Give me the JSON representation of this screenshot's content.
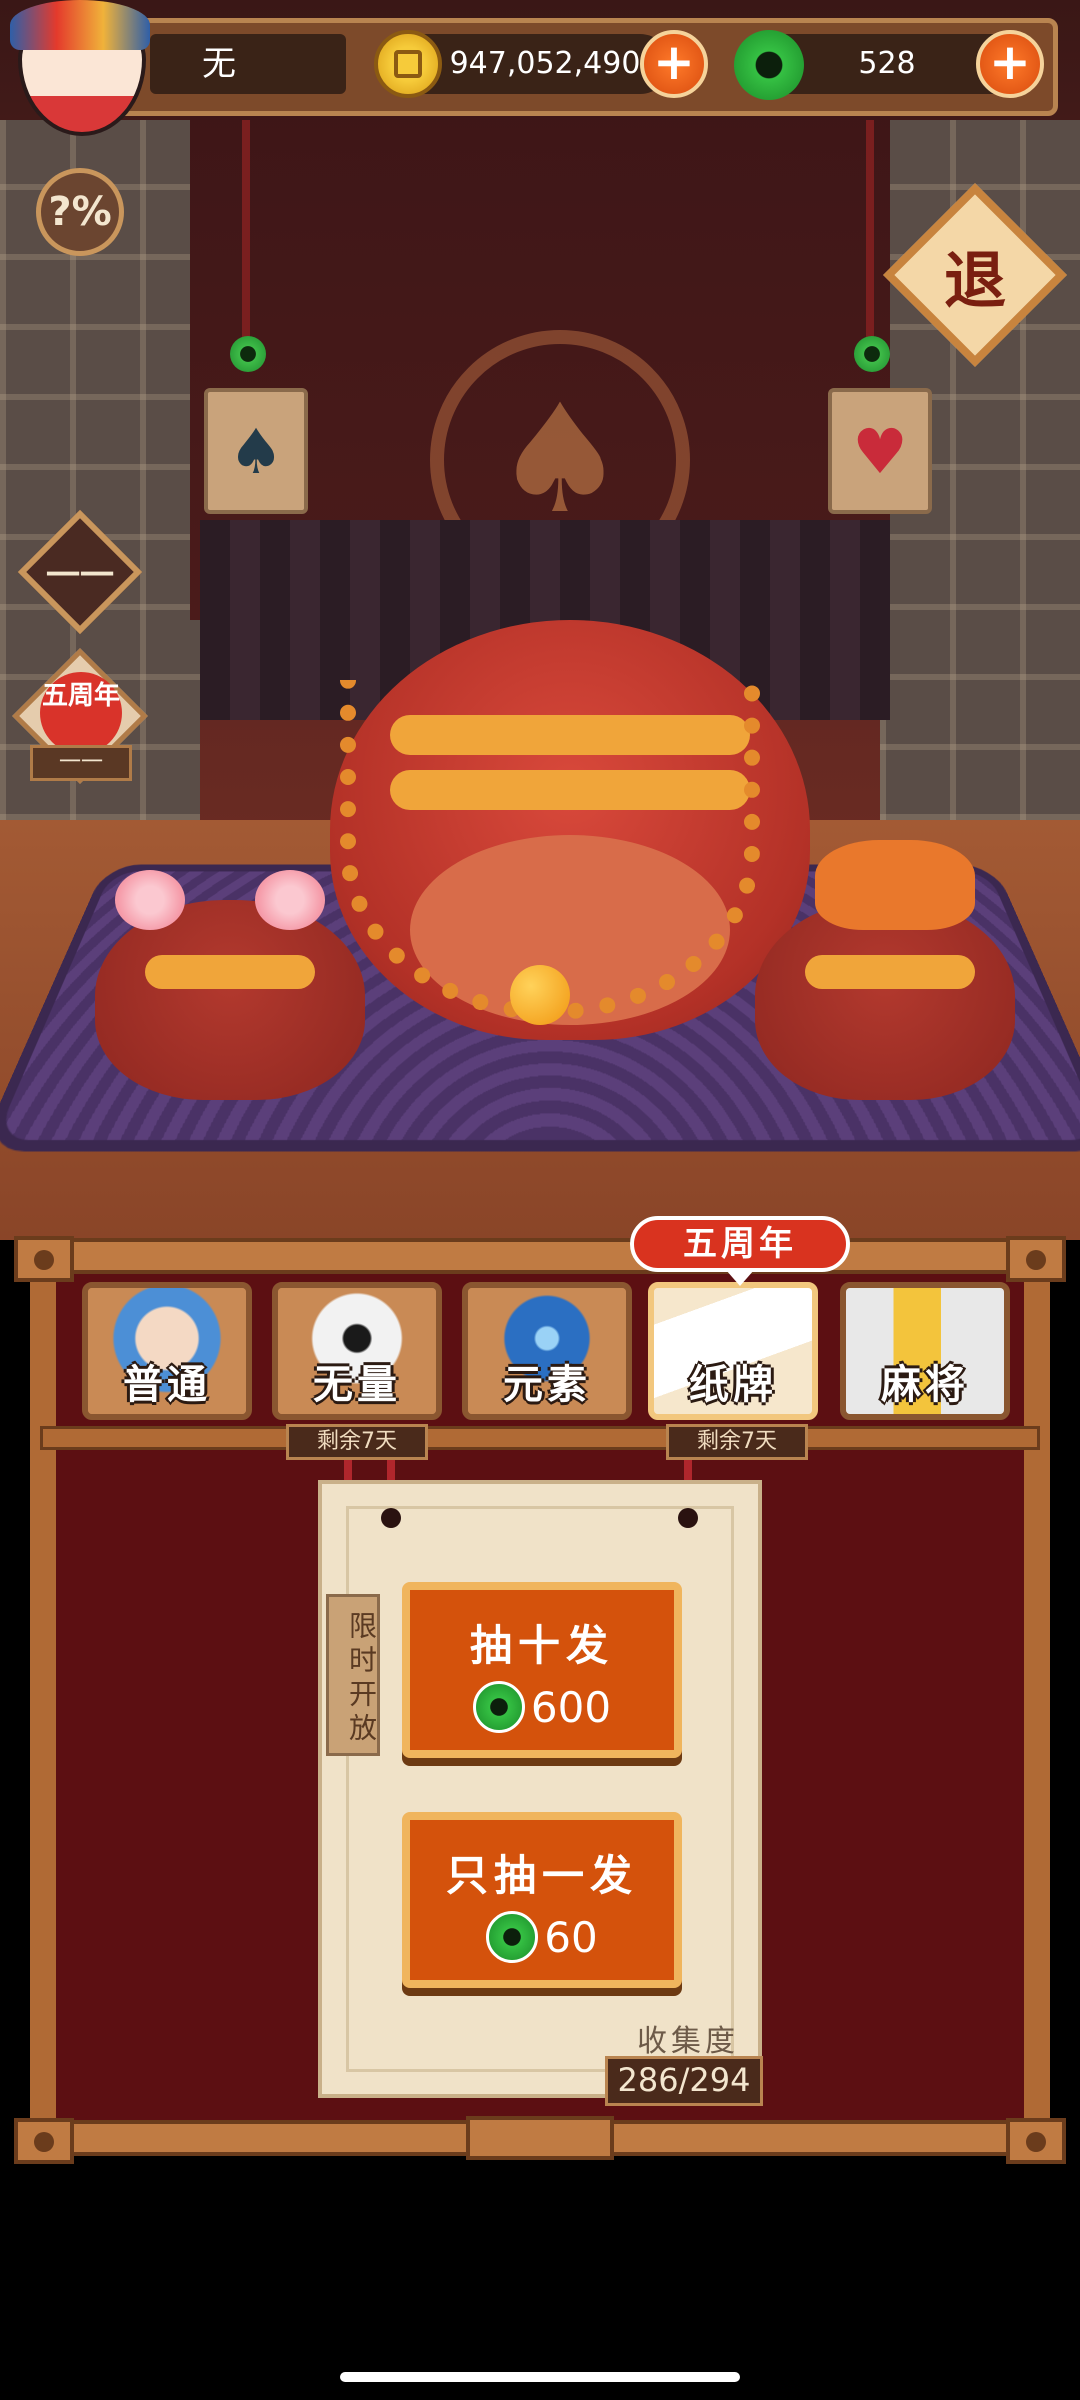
{
  "header": {
    "player_name": "无",
    "coins": "947,052,490",
    "gems": "528"
  },
  "side": {
    "odds_label": "?%",
    "exit_label": "退",
    "hidden_label": "一一",
    "anniversary_badge": "五周年",
    "anniversary_label": "一一"
  },
  "tabs": [
    {
      "label": "普通",
      "remaining": ""
    },
    {
      "label": "无量",
      "remaining": "剩余7天"
    },
    {
      "label": "元素",
      "remaining": ""
    },
    {
      "label": "纸牌",
      "remaining": "剩余7天",
      "ribbon": "五周年"
    },
    {
      "label": "麻将",
      "remaining": ""
    }
  ],
  "scroll": {
    "tag": "限时开放",
    "draw_ten": {
      "title": "抽十发",
      "cost": "600"
    },
    "draw_one": {
      "title": "只抽一发",
      "cost": "60"
    },
    "collection_label": "收集度",
    "collection_value": "286/294"
  },
  "icons": [
    "spade-icon",
    "heart-icon",
    "coin-icon",
    "gem-icon",
    "plus-icon"
  ],
  "colors": {
    "accent": "#d4520c",
    "panel": "#5c0f12",
    "frame": "#b06a35"
  }
}
